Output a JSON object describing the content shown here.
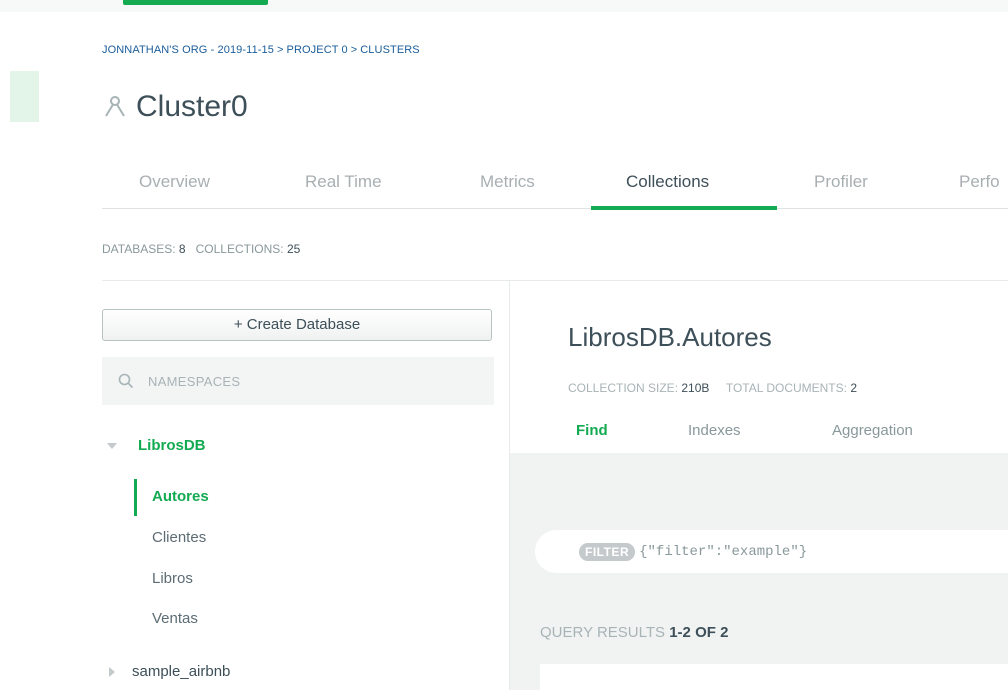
{
  "breadcrumb": {
    "org": "JONNATHAN'S ORG - 2019-11-15",
    "project": "PROJECT 0",
    "section": "CLUSTERS",
    "separator": ">"
  },
  "cluster": {
    "title": "Cluster0",
    "icon": "cluster-icon"
  },
  "tabs": [
    {
      "label": "Overview"
    },
    {
      "label": "Real Time"
    },
    {
      "label": "Metrics"
    },
    {
      "label": "Collections"
    },
    {
      "label": "Profiler"
    },
    {
      "label": "Perfo"
    }
  ],
  "active_tab": "Collections",
  "stats": {
    "databases_label": "DATABASES:",
    "databases_count": "8",
    "collections_label": "COLLECTIONS:",
    "collections_count": "25"
  },
  "sidebar": {
    "create_label": "+ Create Database",
    "search_placeholder": "NAMESPACES",
    "databases": [
      {
        "name": "LibrosDB",
        "expanded": true,
        "collections": [
          "Autores",
          "Clientes",
          "Libros",
          "Ventas"
        ]
      },
      {
        "name": "sample_airbnb",
        "expanded": false
      }
    ],
    "active_collection": "Autores"
  },
  "collection": {
    "title": "LibrosDB.Autores",
    "size_label": "COLLECTION SIZE:",
    "size_value": "210B",
    "docs_label": "TOTAL DOCUMENTS:",
    "docs_value": "2",
    "subtabs": [
      "Find",
      "Indexes",
      "Aggregation"
    ],
    "active_subtab": "Find"
  },
  "filter": {
    "badge": "FILTER",
    "placeholder": "{\"filter\":\"example\"}"
  },
  "results": {
    "label": "QUERY RESULTS",
    "range": "1-2 OF 2"
  },
  "colors": {
    "accent": "#13aa52",
    "link": "#1a5d9a",
    "text": "#3d4f58"
  }
}
